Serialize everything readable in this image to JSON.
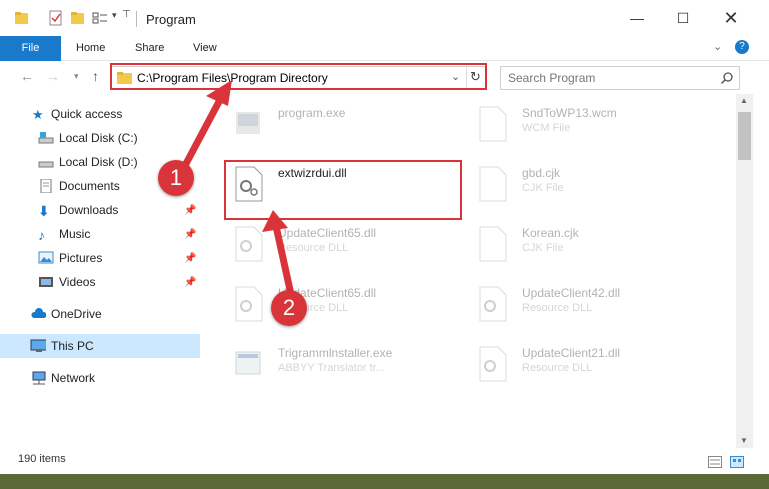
{
  "window": {
    "title": "Program"
  },
  "ribbon": {
    "tabs": [
      "File",
      "Home",
      "Share",
      "View"
    ]
  },
  "address": {
    "path": "C:\\Program Files\\Program Directory"
  },
  "search": {
    "placeholder": "Search Program"
  },
  "nav": {
    "items": [
      {
        "label": "Quick access"
      },
      {
        "label": "Local Disk (C:)"
      },
      {
        "label": "Local Disk (D:)"
      },
      {
        "label": "Documents"
      },
      {
        "label": "Downloads"
      },
      {
        "label": "Music"
      },
      {
        "label": "Pictures"
      },
      {
        "label": "Videos"
      },
      {
        "label": "OneDrive"
      },
      {
        "label": "This PC"
      },
      {
        "label": "Network"
      }
    ]
  },
  "files": {
    "left": [
      {
        "name": "program.exe",
        "type": ""
      },
      {
        "name": "extwizrdui.dll",
        "type": ""
      },
      {
        "name": "UpdateClient65.dll",
        "type": "Resource DLL"
      },
      {
        "name": "UpdateClient65.dll",
        "type": "Resource DLL"
      },
      {
        "name": "Trigrammlnstaller.exe",
        "type": "ABBYY Translator tr..."
      }
    ],
    "right": [
      {
        "name": "SndToWP13.wcm",
        "type": "WCM File"
      },
      {
        "name": "gbd.cjk",
        "type": "CJK File"
      },
      {
        "name": "Korean.cjk",
        "type": "CJK File"
      },
      {
        "name": "UpdateClient42.dll",
        "type": "Resource DLL"
      },
      {
        "name": "UpdateClient21.dll",
        "type": "Resource DLL"
      }
    ]
  },
  "status": {
    "count": "190 items"
  },
  "annotations": {
    "step1": "1",
    "step2": "2"
  },
  "colors": {
    "accent": "#1979ca",
    "highlight": "#d9343a",
    "selected": "#cce8ff"
  }
}
